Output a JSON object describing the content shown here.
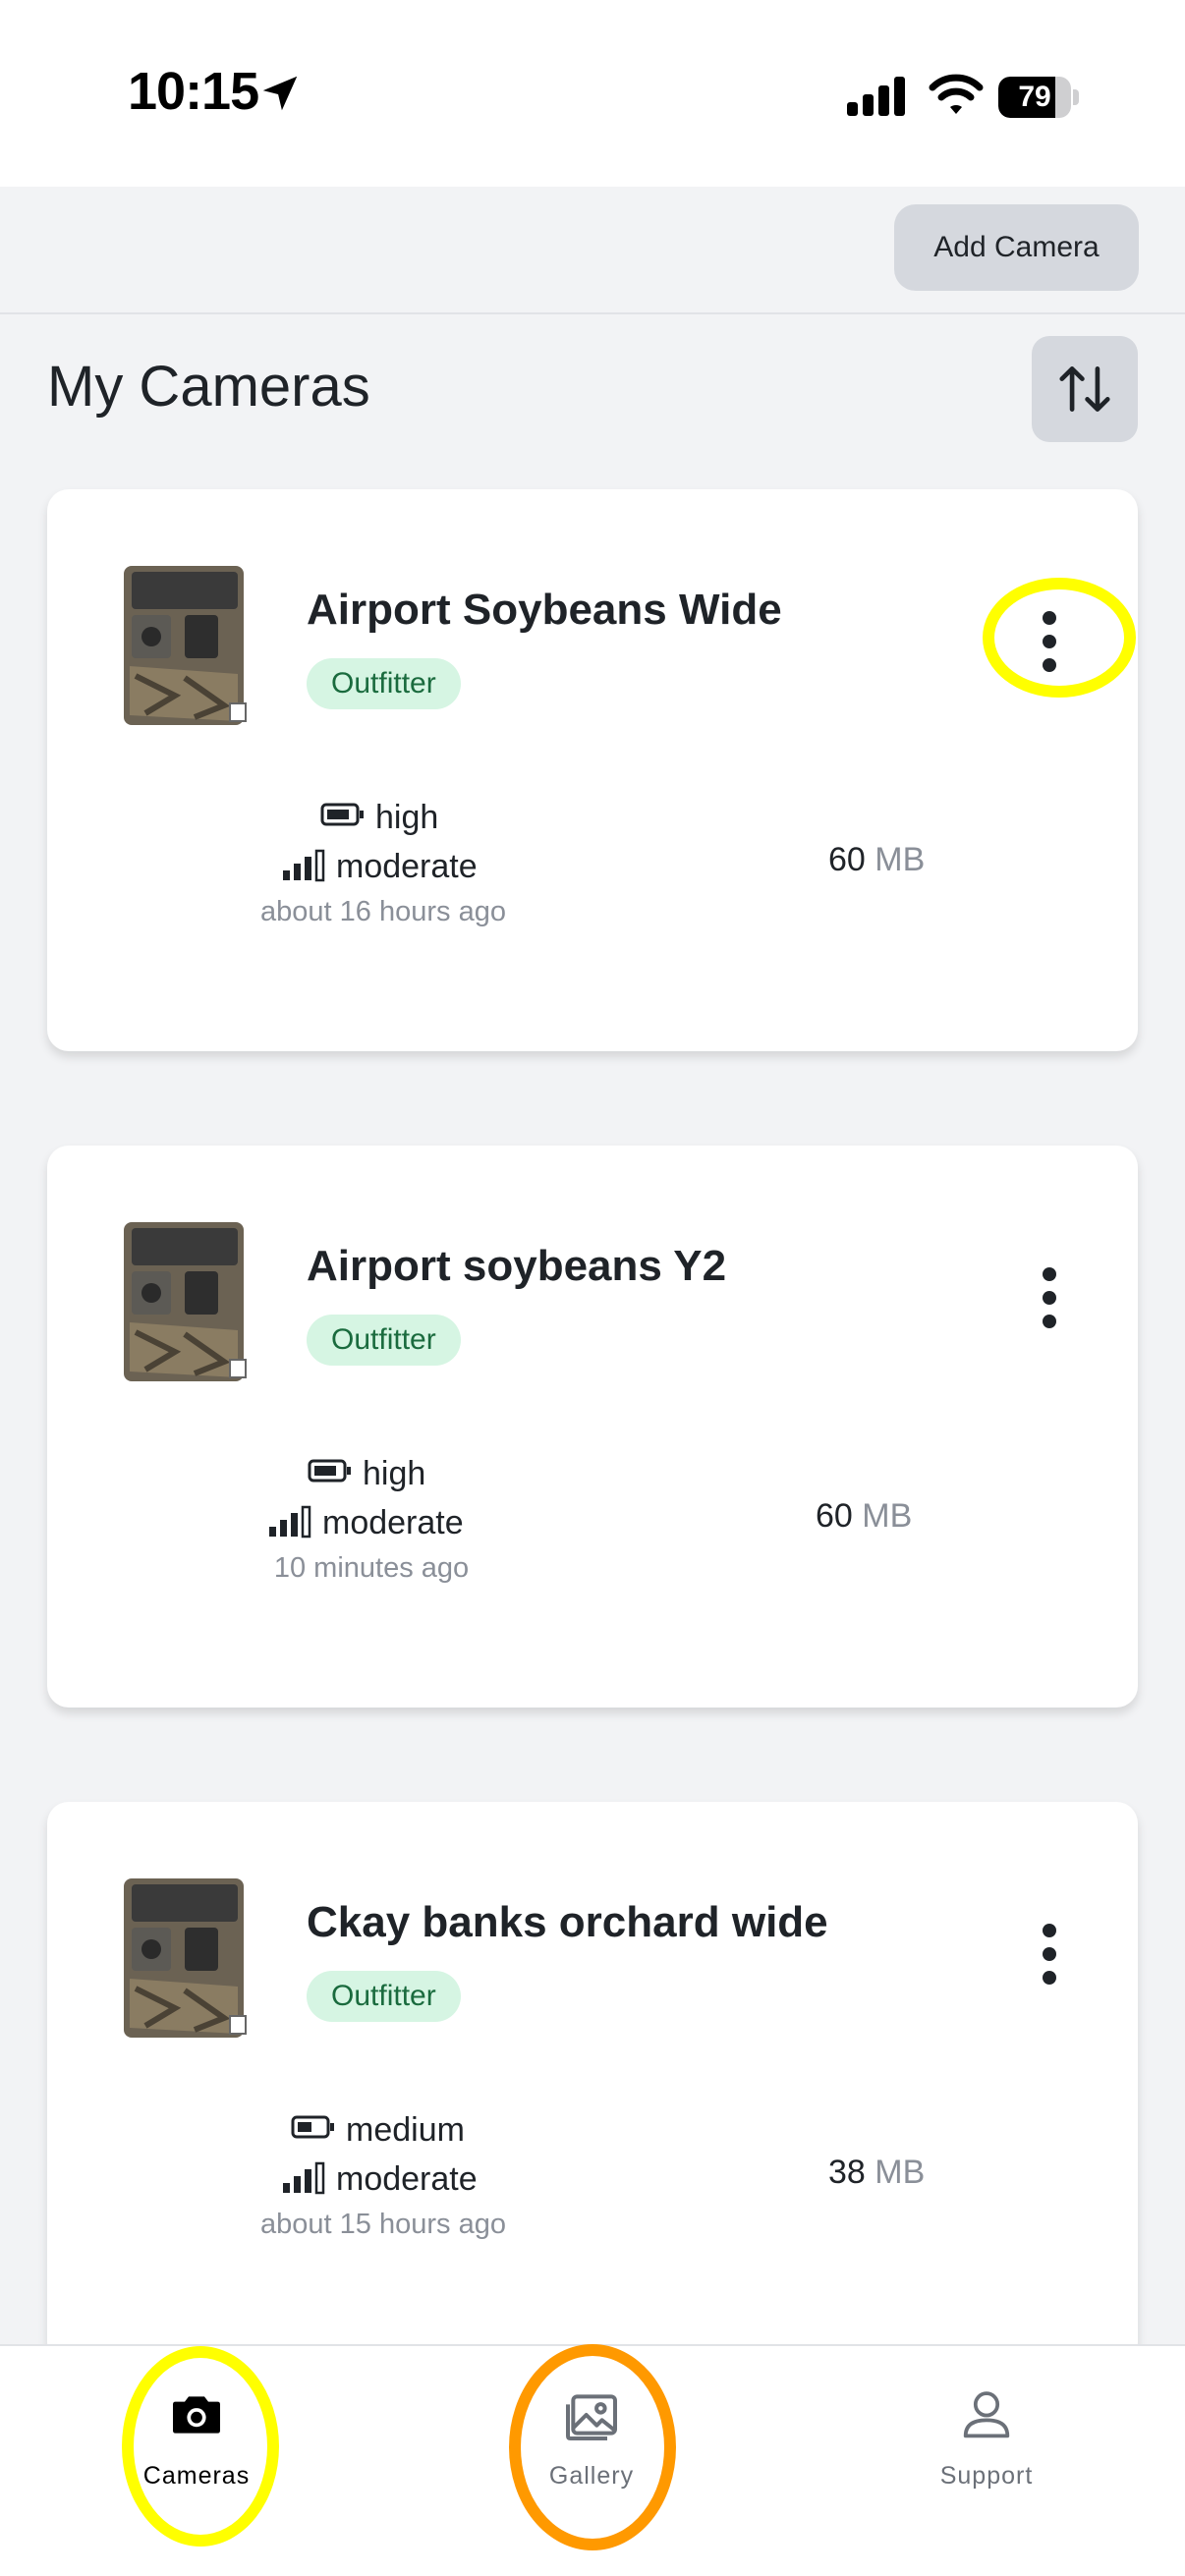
{
  "status_bar": {
    "time": "10:15",
    "battery_level": 79,
    "battery_text": "79"
  },
  "header": {
    "add_camera_label": "Add Camera"
  },
  "page": {
    "title": "My Cameras"
  },
  "cameras": [
    {
      "name": "Airport Soybeans Wide",
      "badge": "Outfitter",
      "battery": "high",
      "signal": "moderate",
      "updated": "about 16 hours ago",
      "storage_value": "60",
      "storage_unit": "MB"
    },
    {
      "name": "Airport soybeans Y2",
      "badge": "Outfitter",
      "battery": "high",
      "signal": "moderate",
      "updated": "10 minutes ago",
      "storage_value": "60",
      "storage_unit": "MB"
    },
    {
      "name": "Ckay banks orchard wide",
      "badge": "Outfitter",
      "battery": "medium",
      "signal": "moderate",
      "updated": "about 15 hours ago",
      "storage_value": "38",
      "storage_unit": "MB"
    }
  ],
  "tabbar": {
    "items": [
      {
        "label": "Cameras",
        "icon": "camera-icon"
      },
      {
        "label": "Gallery",
        "icon": "gallery-icon"
      },
      {
        "label": "Support",
        "icon": "person-icon"
      }
    ]
  },
  "colors": {
    "highlight_yellow": "#ffff00",
    "highlight_orange": "#ff9900",
    "badge_bg": "#d6f5e3",
    "badge_text": "#1a6b3e"
  }
}
